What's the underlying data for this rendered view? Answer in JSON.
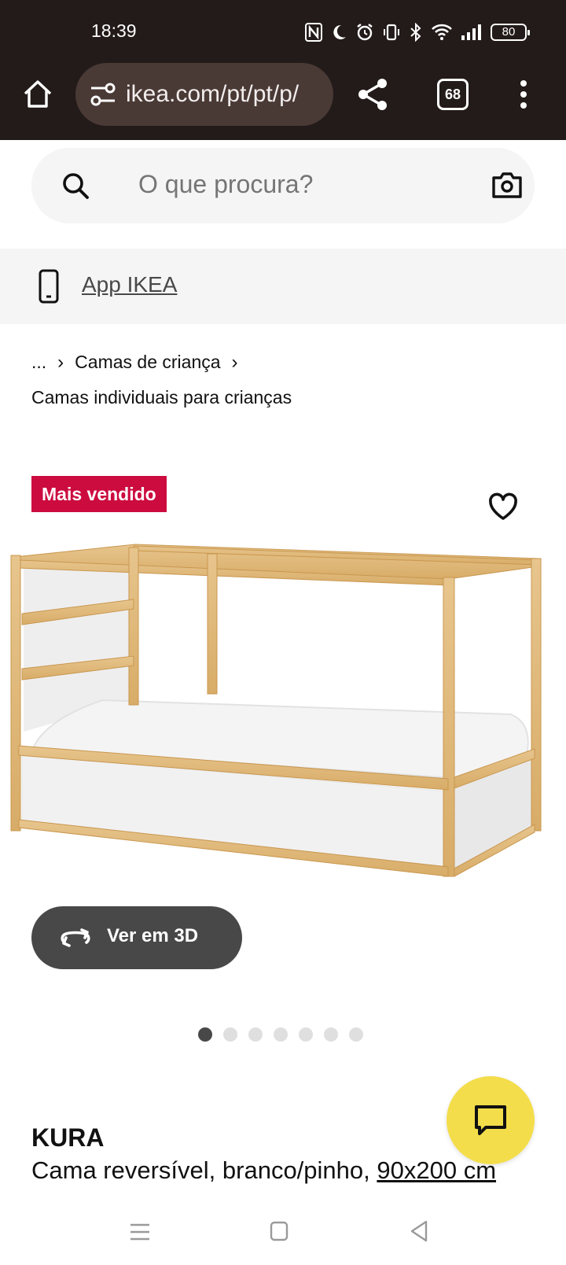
{
  "status_bar": {
    "time": "18:39",
    "battery": "80",
    "icons": [
      "nfc-icon",
      "moon-icon",
      "alarm-icon",
      "vibrate-icon",
      "bluetooth-icon",
      "wifi-icon",
      "signal-icon",
      "battery-icon"
    ]
  },
  "browser": {
    "url": "ikea.com/pt/pt/p/",
    "tab_count": "68"
  },
  "search": {
    "placeholder": "O que procura?"
  },
  "app_banner": {
    "label": "App IKEA"
  },
  "breadcrumb": {
    "items": [
      "...",
      "Camas de criança",
      "Camas individuais para crianças"
    ]
  },
  "product": {
    "badge": "Mais vendido",
    "view_3d_label": "Ver em 3D",
    "name": "KURA",
    "description": "Cama reversível, branco/pinho, ",
    "size": "90x200 cm",
    "image_count": 7,
    "active_image_index": 0
  },
  "colors": {
    "chrome_bg": "#231b19",
    "badge_bg": "#cc0b3f",
    "chat_bg": "#f3dd4a",
    "dark_button": "#484848"
  }
}
